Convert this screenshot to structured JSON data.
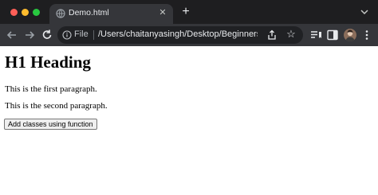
{
  "tab": {
    "title": "Demo.html"
  },
  "omnibox": {
    "scheme_label": "File",
    "url": "/Users/chaitanyasingh/Desktop/BeginnersBook/..."
  },
  "page": {
    "heading": "H1 Heading",
    "paragraph1": "This is the first paragraph.",
    "paragraph2": "This is the second paragraph.",
    "button_label": "Add classes using function"
  },
  "icons": {
    "favicon": "globe-icon",
    "close": "close-icon",
    "new_tab": "plus-icon",
    "back": "arrow-left-icon",
    "forward": "arrow-right-icon",
    "reload": "reload-icon",
    "info": "info-icon",
    "share": "share-icon",
    "star": "star-icon",
    "reading_list": "reading-list-icon",
    "side_panel": "side-panel-icon",
    "menu": "kebab-icon"
  },
  "colors": {
    "titlebar": "#1e1e20",
    "toolbar": "#35363a",
    "omnibox": "#202124",
    "traffic_red": "#ff5f57",
    "traffic_yellow": "#febc2e",
    "traffic_green": "#28c840"
  }
}
